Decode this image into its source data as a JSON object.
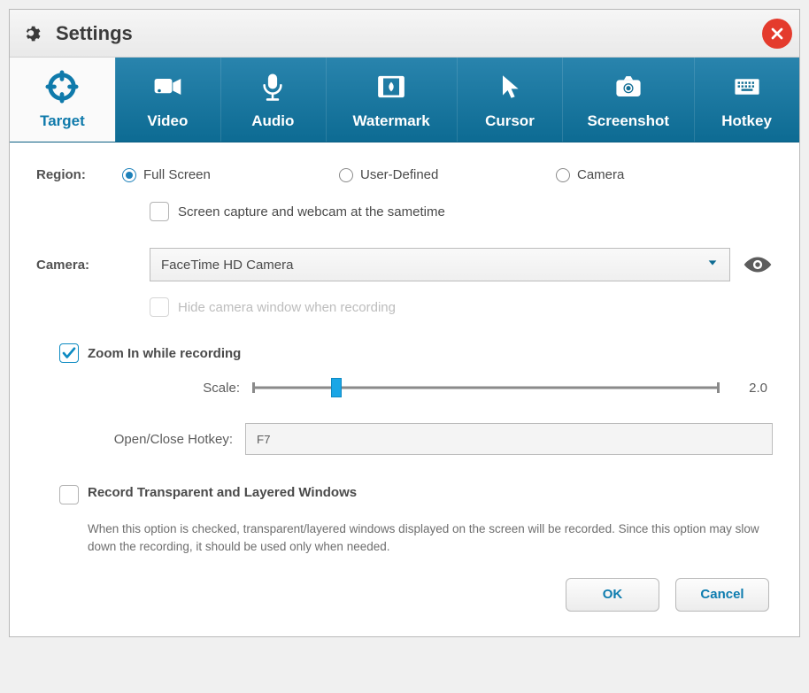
{
  "window": {
    "title": "Settings"
  },
  "tabs": {
    "target": "Target",
    "video": "Video",
    "audio": "Audio",
    "watermark": "Watermark",
    "cursor": "Cursor",
    "screenshot": "Screenshot",
    "hotkey": "Hotkey"
  },
  "target": {
    "region_label": "Region:",
    "region_options": {
      "full_screen": "Full Screen",
      "user_defined": "User-Defined",
      "camera": "Camera"
    },
    "capture_webcam_same_time": "Screen capture and webcam at the sametime",
    "camera_label": "Camera:",
    "camera_selected": "FaceTime HD Camera",
    "hide_camera_window": "Hide camera window when recording",
    "zoom_in_label": "Zoom In while recording",
    "scale_label": "Scale:",
    "scale_value": "2.0",
    "hotkey_label": "Open/Close Hotkey:",
    "hotkey_value": "F7",
    "record_transparent_label": "Record Transparent and Layered Windows",
    "record_transparent_desc": "When this option is checked, transparent/layered windows displayed on the screen will be recorded. Since this option may slow down the recording, it should be used only when needed."
  },
  "footer": {
    "ok": "OK",
    "cancel": "Cancel"
  }
}
